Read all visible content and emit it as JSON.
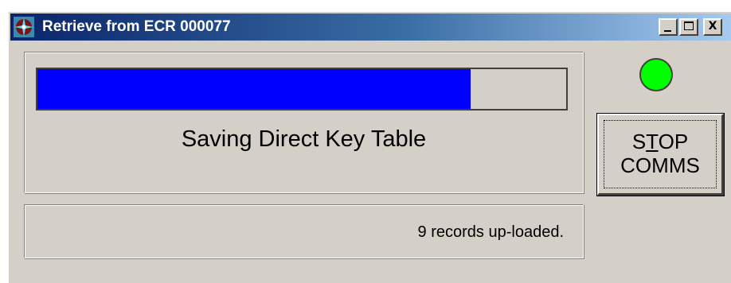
{
  "window": {
    "title": "Retrieve from ECR 000077",
    "controls": {
      "minimize": "_",
      "maximize": "□",
      "close": "X"
    }
  },
  "progress": {
    "fraction": 0.82,
    "label": "Saving Direct Key Table",
    "fill_color": "#0000ff"
  },
  "status": {
    "message": "9 records up-loaded."
  },
  "indicator": {
    "state": "on",
    "color": "#00ff00"
  },
  "stop_button": {
    "line1_before": "S",
    "line1_mnemonic": "T",
    "line1_after": "OP",
    "line2": "COMMS"
  },
  "icons": {
    "app": "compass-icon",
    "minimize": "minimize-icon",
    "maximize": "maximize-icon",
    "close": "close-icon"
  }
}
